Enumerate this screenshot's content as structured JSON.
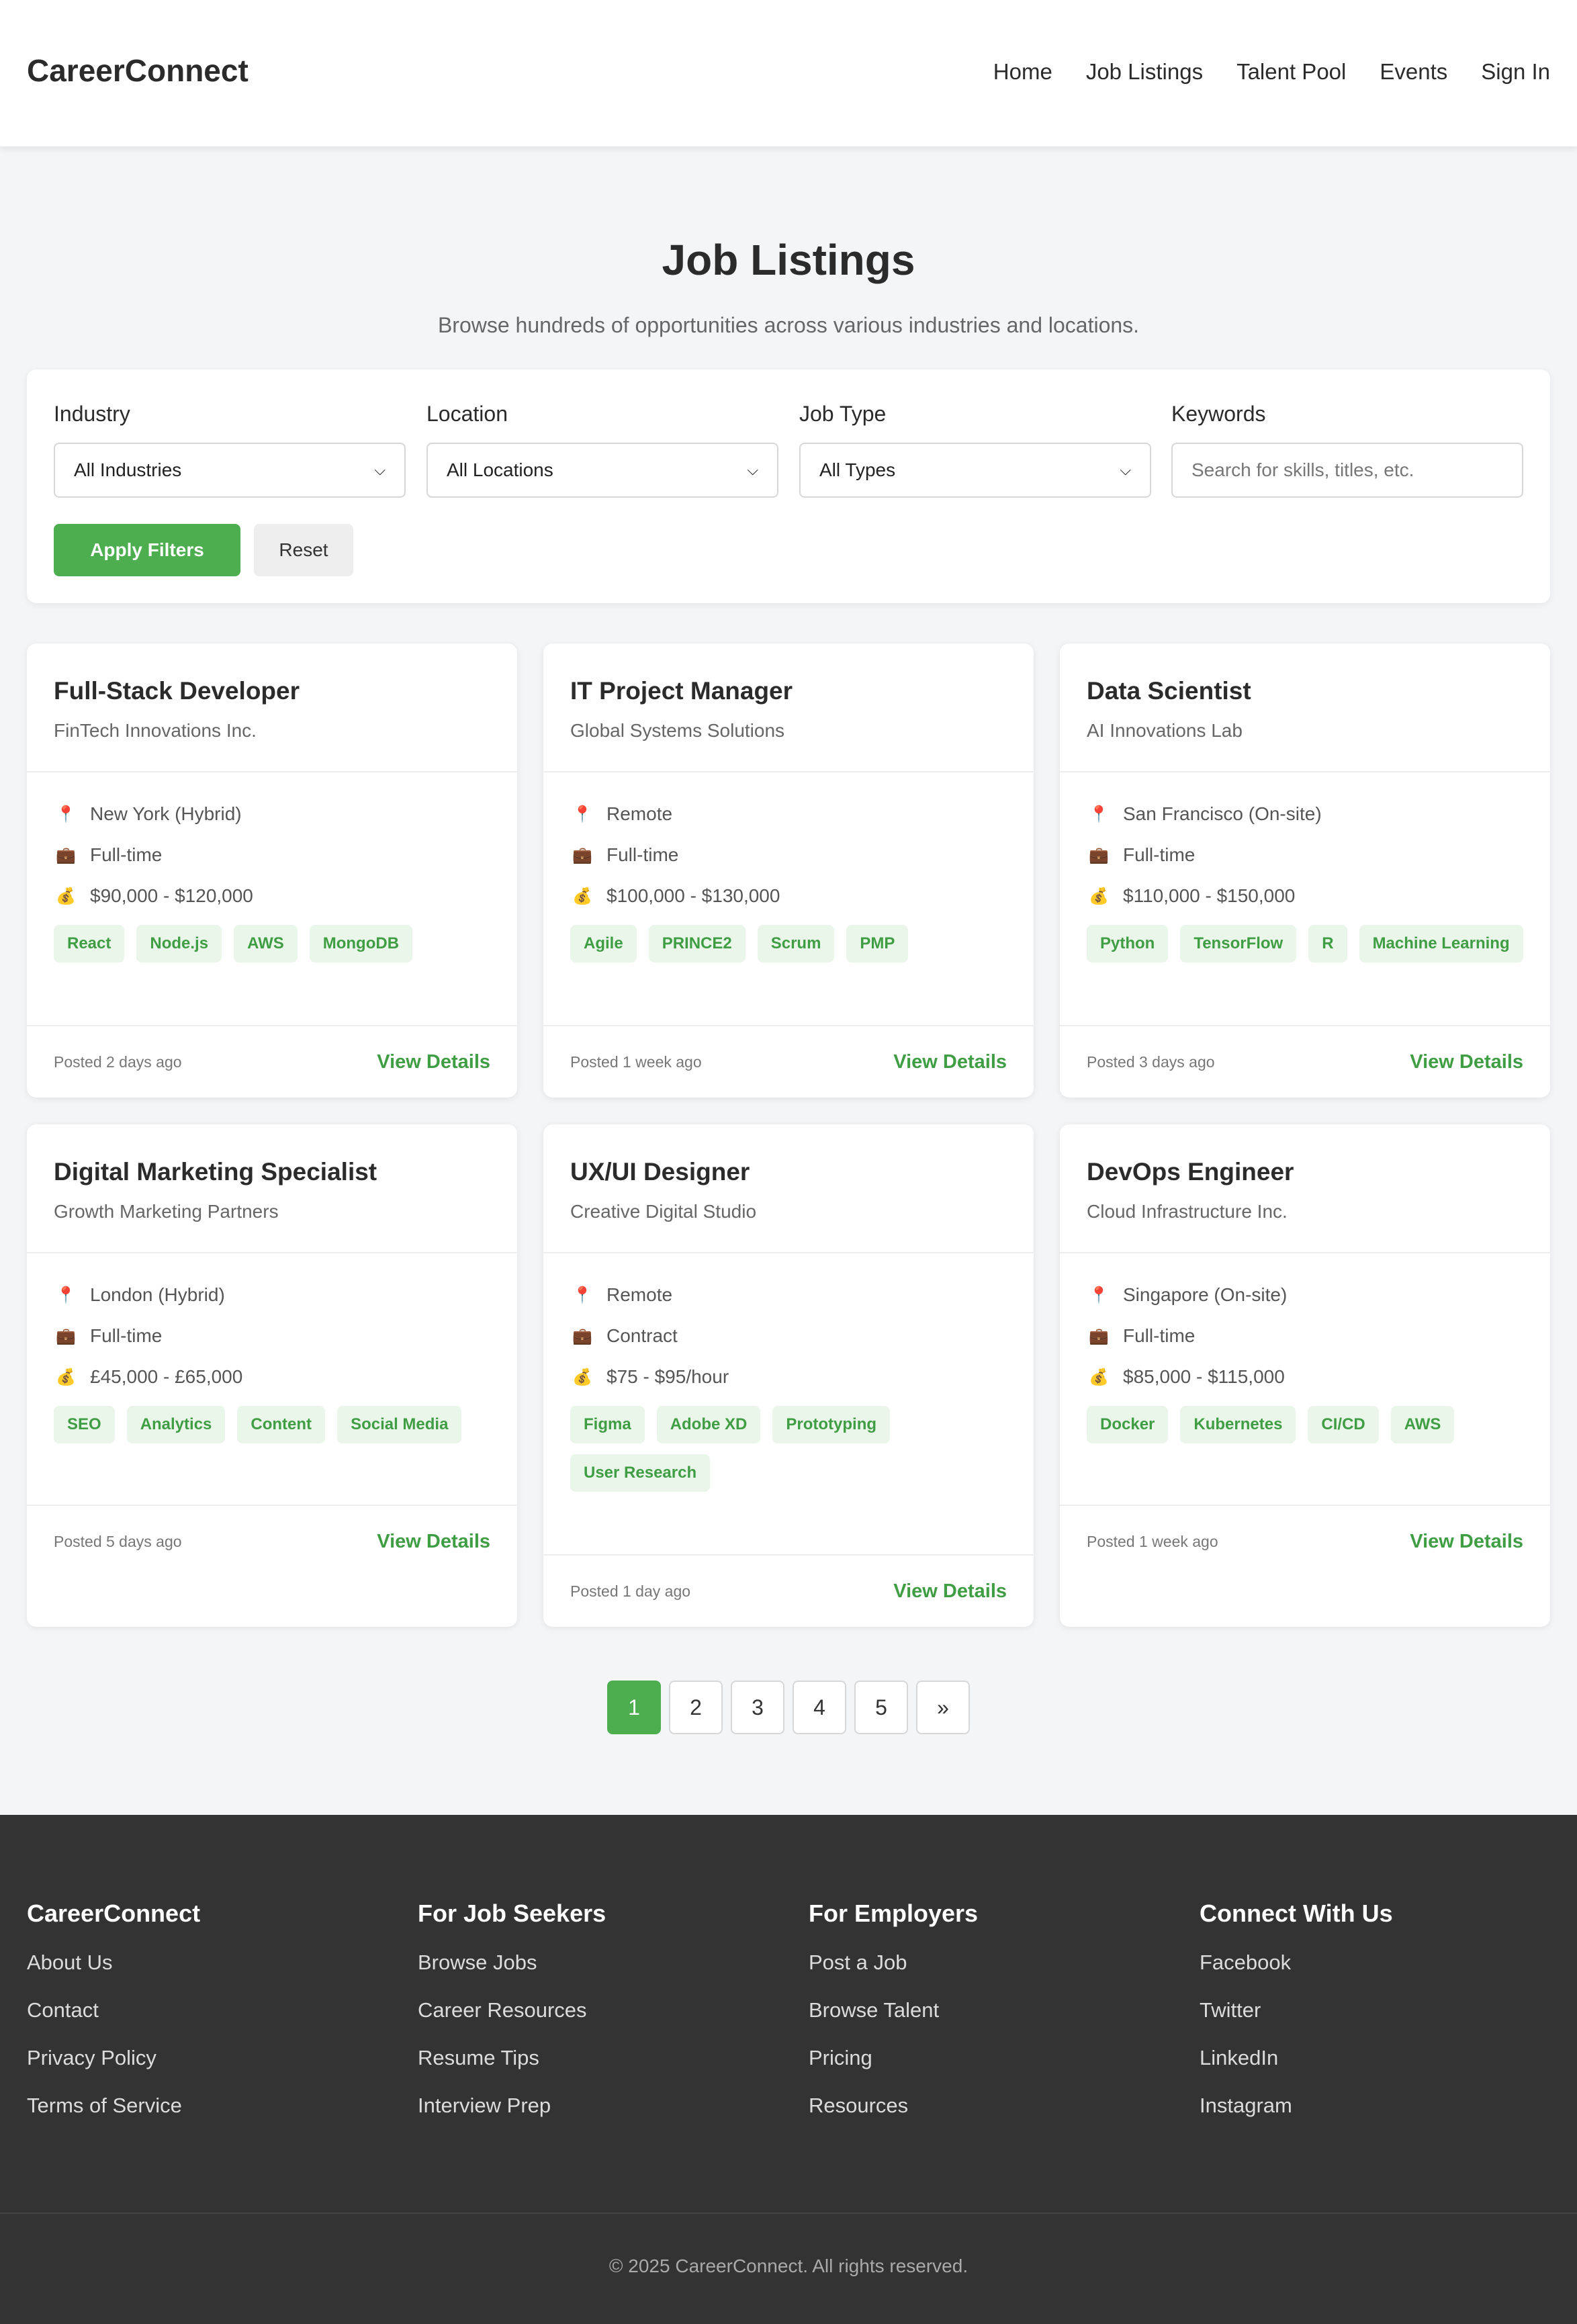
{
  "brand": "CareerConnect",
  "nav": [
    "Home",
    "Job Listings",
    "Talent Pool",
    "Events",
    "Sign In"
  ],
  "hero": {
    "title": "Job Listings",
    "subtitle": "Browse hundreds of opportunities across various industries and locations."
  },
  "filters": {
    "industry": {
      "label": "Industry",
      "value": "All Industries"
    },
    "location": {
      "label": "Location",
      "value": "All Locations"
    },
    "job_type": {
      "label": "Job Type",
      "value": "All Types"
    },
    "keywords": {
      "label": "Keywords",
      "placeholder": "Search for skills, titles, etc."
    },
    "apply_label": "Apply Filters",
    "reset_label": "Reset"
  },
  "icons": {
    "location": "pin-icon",
    "type": "briefcase-icon",
    "salary": "money-bag-icon"
  },
  "jobs": [
    {
      "title": "Full-Stack Developer",
      "company": "FinTech Innovations Inc.",
      "location": "New York (Hybrid)",
      "type": "Full-time",
      "salary": "$90,000 - $120,000",
      "tags": [
        "React",
        "Node.js",
        "AWS",
        "MongoDB"
      ],
      "posted": "Posted 2 days ago",
      "action": "View Details"
    },
    {
      "title": "IT Project Manager",
      "company": "Global Systems Solutions",
      "location": "Remote",
      "type": "Full-time",
      "salary": "$100,000 - $130,000",
      "tags": [
        "Agile",
        "PRINCE2",
        "Scrum",
        "PMP"
      ],
      "posted": "Posted 1 week ago",
      "action": "View Details"
    },
    {
      "title": "Data Scientist",
      "company": "AI Innovations Lab",
      "location": "San Francisco (On-site)",
      "type": "Full-time",
      "salary": "$110,000 - $150,000",
      "tags": [
        "Python",
        "TensorFlow",
        "R",
        "Machine Learning"
      ],
      "posted": "Posted 3 days ago",
      "action": "View Details"
    },
    {
      "title": "Digital Marketing Specialist",
      "company": "Growth Marketing Partners",
      "location": "London (Hybrid)",
      "type": "Full-time",
      "salary": "£45,000 - £65,000",
      "tags": [
        "SEO",
        "Analytics",
        "Content",
        "Social Media"
      ],
      "posted": "Posted 5 days ago",
      "action": "View Details"
    },
    {
      "title": "UX/UI Designer",
      "company": "Creative Digital Studio",
      "location": "Remote",
      "type": "Contract",
      "salary": "$75 - $95/hour",
      "tags": [
        "Figma",
        "Adobe XD",
        "Prototyping",
        "User Research"
      ],
      "posted": "Posted 1 day ago",
      "action": "View Details"
    },
    {
      "title": "DevOps Engineer",
      "company": "Cloud Infrastructure Inc.",
      "location": "Singapore (On-site)",
      "type": "Full-time",
      "salary": "$85,000 - $115,000",
      "tags": [
        "Docker",
        "Kubernetes",
        "CI/CD",
        "AWS"
      ],
      "posted": "Posted 1 week ago",
      "action": "View Details"
    }
  ],
  "pagination": {
    "pages": [
      "1",
      "2",
      "3",
      "4",
      "5"
    ],
    "next": "»",
    "current": "1"
  },
  "footer": {
    "columns": [
      {
        "title": "CareerConnect",
        "links": [
          "About Us",
          "Contact",
          "Privacy Policy",
          "Terms of Service"
        ]
      },
      {
        "title": "For Job Seekers",
        "links": [
          "Browse Jobs",
          "Career Resources",
          "Resume Tips",
          "Interview Prep"
        ]
      },
      {
        "title": "For Employers",
        "links": [
          "Post a Job",
          "Browse Talent",
          "Pricing",
          "Resources"
        ]
      },
      {
        "title": "Connect With Us",
        "links": [
          "Facebook",
          "Twitter",
          "LinkedIn",
          "Instagram"
        ]
      }
    ],
    "copyright": "© 2025 CareerConnect. All rights reserved."
  },
  "colors": {
    "accent": "#4cae4f",
    "tag_bg": "#eaf6ea",
    "footer_bg": "#333333"
  }
}
